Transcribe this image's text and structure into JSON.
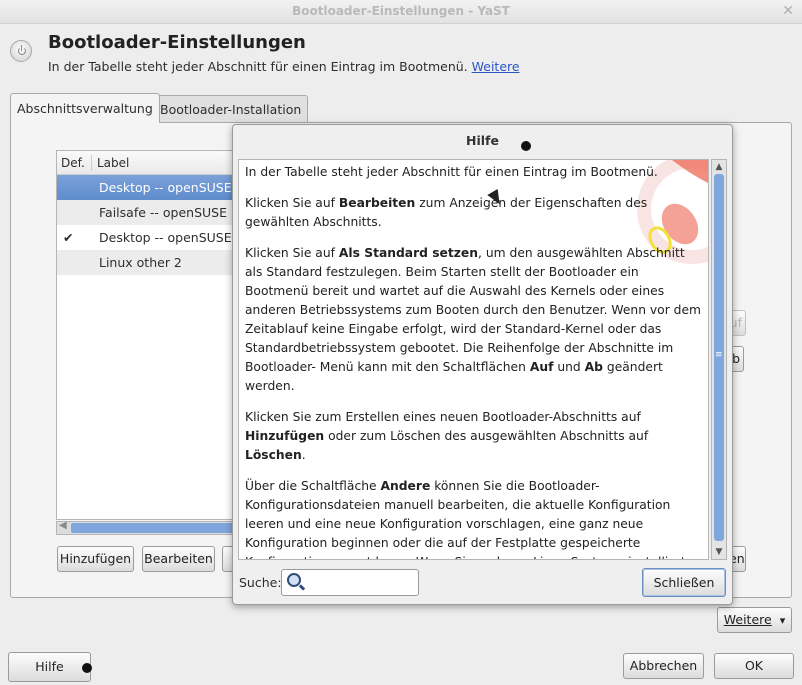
{
  "window": {
    "title": "Bootloader-Einstellungen - YaST",
    "close_glyph": "✕"
  },
  "header": {
    "title": "Bootloader-Einstellungen",
    "subtitle": "In der Tabelle steht jeder Abschnitt für einen Eintrag im Bootmenü.",
    "more_link": "Weitere"
  },
  "tabs": [
    {
      "label": "Abschnittsverwaltung",
      "active": true
    },
    {
      "label": "Bootloader-Installation",
      "active": false
    }
  ],
  "table": {
    "columns": [
      "Def.",
      "Label"
    ],
    "rows": [
      {
        "default": "",
        "label": "Desktop -- openSUSE",
        "selected": true
      },
      {
        "default": "",
        "label": "Failsafe -- openSUSE",
        "selected": false
      },
      {
        "default": "✔",
        "label": "Desktop -- openSUSE",
        "selected": false
      },
      {
        "default": "",
        "label": "Linux other 2",
        "selected": false
      }
    ]
  },
  "actions": {
    "add": "Hinzufügen",
    "edit": "Bearbeiten",
    "partial_right_1": "uf",
    "partial_right_2": "b",
    "partial_right_3": "en"
  },
  "dialog": {
    "title": "Hilfe",
    "paragraphs": [
      "In der Tabelle steht jeder Abschnitt für einen Eintrag im Bootmenü.",
      "Klicken Sie auf <b>Bearbeiten</b> zum Anzeigen der Eigenschaften des gewählten Abschnitts.",
      "Klicken Sie auf <b>Als Standard setzen</b>, um den ausgewählten Abschnitt als Standard festzulegen. Beim Starten stellt der Bootloader ein Bootmenü bereit und wartet auf die Auswahl des Kernels oder eines anderen Betriebssystems zum Booten durch den Benutzer. Wenn vor dem Zeitablauf keine Eingabe erfolgt, wird der Standard-Kernel oder das Standardbetriebssystem gebootet. Die Reihenfolge der Abschnitte im Bootloader- Menü kann mit den Schaltflächen <b>Auf</b> und <b>Ab</b> geändert werden.",
      "Klicken Sie zum Erstellen eines neuen Bootloader-Abschnitts auf <b>Hinzufügen</b> oder zum Löschen des ausgewählten Abschnitts auf <b>Löschen</b>.",
      "Über die Schaltfläche <b>Andere</b> können Sie die Bootloader-Konfigurationsdateien manuell bearbeiten, die aktuelle Konfiguration leeren und eine neue Konfiguration vorschlagen, eine ganz neue Konfiguration beginnen oder die auf der Festplatte gespeicherte Konfiguration erneut lesen. Wenn Sie mehrere Linux-Systeme installiert haben, kann YaST diese suchen und ihre Menüs zusammenführen."
    ],
    "search_label": "Suche:",
    "search_value": "",
    "close_label": "Schließen"
  },
  "footer": {
    "more_dropdown": "Weitere",
    "help": "Hilfe",
    "cancel": "Abbrechen",
    "ok": "OK"
  },
  "colors": {
    "selection": "#6a94d2",
    "link": "#2a55c5",
    "scroll_thumb": "#7fa6dd"
  },
  "icons": [
    "power-icon",
    "search-icon",
    "lifebuoy-icon",
    "check-icon",
    "dropdown-arrow-icon"
  ]
}
